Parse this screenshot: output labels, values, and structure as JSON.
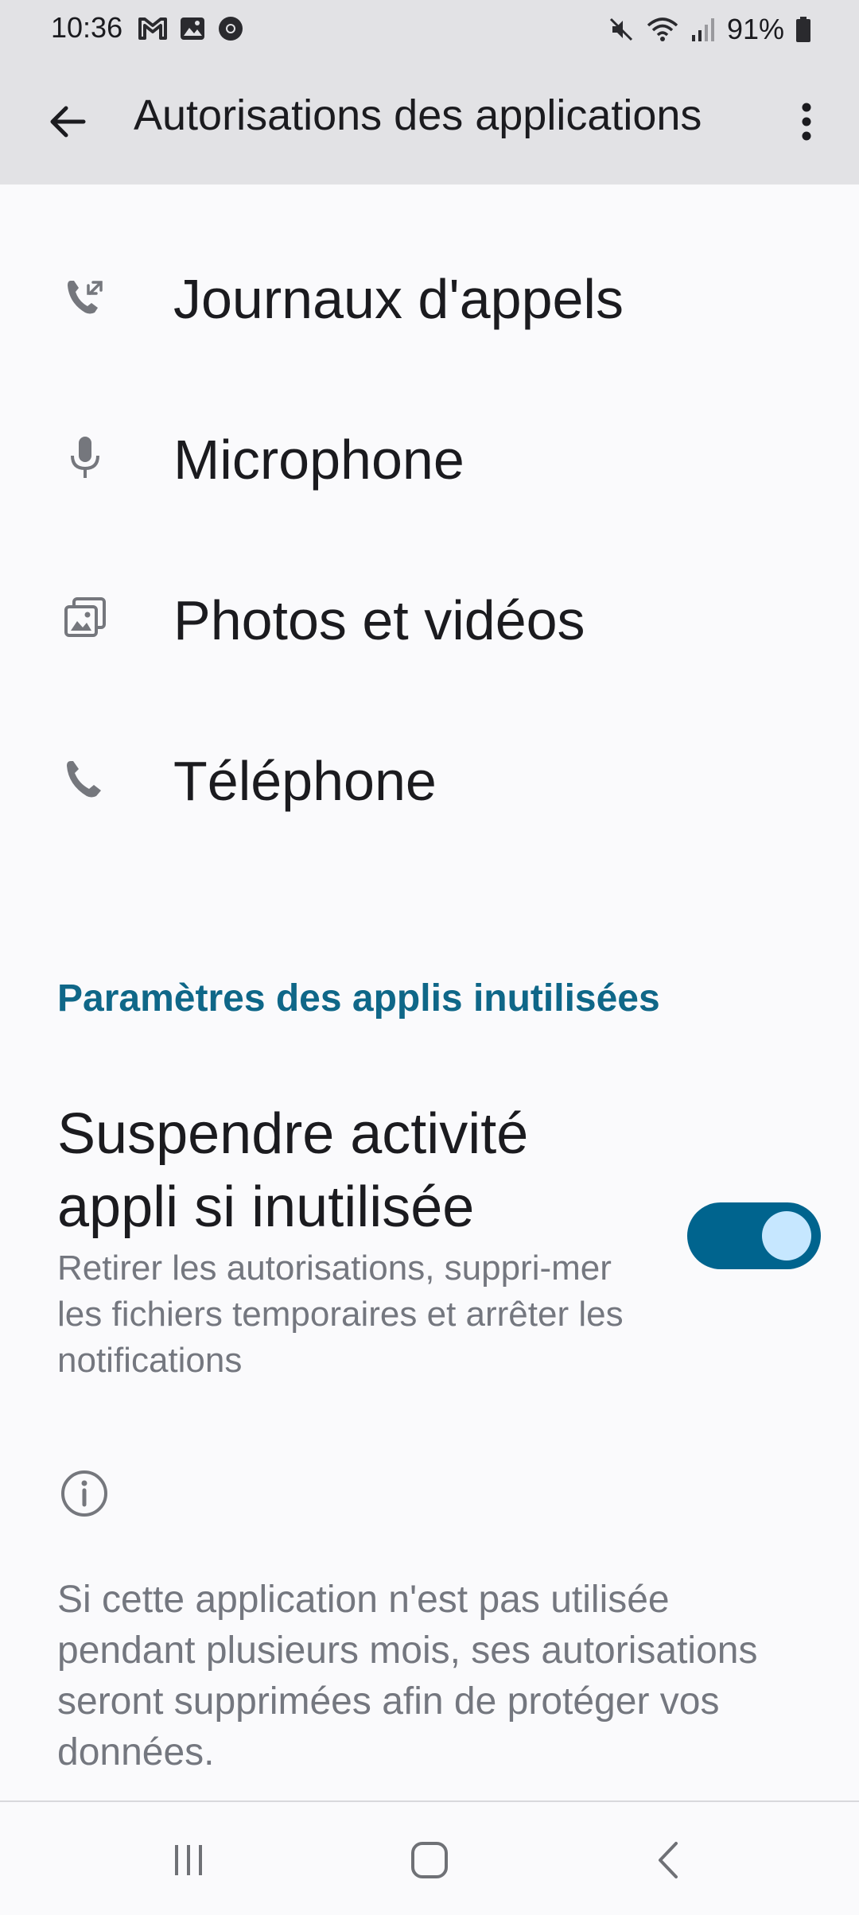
{
  "status_bar": {
    "time": "10:36",
    "battery": "91%",
    "left_icons": [
      "gmail-icon",
      "gallery-icon",
      "chrome-icon"
    ],
    "right_icons": [
      "mute-icon",
      "wifi-icon",
      "signal-icon",
      "battery-icon"
    ]
  },
  "app_bar": {
    "title": "Autorisations des applications",
    "back_icon": "arrow-left-icon",
    "menu_icon": "more-vert-icon"
  },
  "permissions": [
    {
      "label": "Journaux d'appels",
      "icon": "call-log-icon"
    },
    {
      "label": "Microphone",
      "icon": "microphone-icon"
    },
    {
      "label": "Photos et vidéos",
      "icon": "photos-icon"
    },
    {
      "label": "Téléphone",
      "icon": "phone-icon"
    }
  ],
  "unused_section": {
    "header": "Paramètres des applis inutilisées",
    "toggle": {
      "title": "Suspendre activité appli si inutilisée",
      "summary": "Retirer les autorisations, suppri-mer les fichiers temporaires et arrêter les notifications",
      "checked": true
    },
    "info_text": "Si cette application n'est pas utilisée pendant plusieurs mois, ses autorisations seront supprimées afin de protéger vos données."
  },
  "colors": {
    "accent": "#00648e",
    "section_header": "#0f6788",
    "thumb": "#c6e7ff",
    "bar_background": "#e2e2e5",
    "background": "#fafafc",
    "secondary_text": "#74777f"
  }
}
